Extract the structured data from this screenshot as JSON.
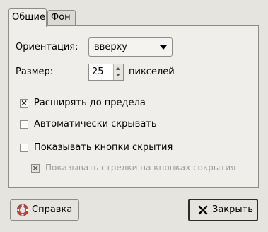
{
  "tabs": [
    {
      "label": "Общие",
      "active": true
    },
    {
      "label": "Фон",
      "active": false
    }
  ],
  "orientation": {
    "label": "Ориентация:",
    "value": "вверху"
  },
  "size": {
    "label": "Размер:",
    "value": "25",
    "unit": "пикселей"
  },
  "options": {
    "expand": {
      "label": "Расширять до предела",
      "checked": true
    },
    "autohide": {
      "label": "Автоматически скрывать",
      "checked": false
    },
    "show_hide_buttons": {
      "label": "Показывать кнопки скрытия",
      "checked": false
    },
    "show_arrows": {
      "label": "Показывать стрелки на кнопках сокрытия",
      "checked": true,
      "enabled": false
    }
  },
  "buttons": {
    "help": "Справка",
    "close": "Закрыть"
  },
  "icons": {
    "help": "lifebuoy-icon",
    "close": "close-x-icon"
  },
  "colors": {
    "window_bg": "#e6e4df",
    "panel_bg": "#efeeeb",
    "disabled_text": "#9d9b97",
    "help_icon_red": "#d73a2f"
  }
}
